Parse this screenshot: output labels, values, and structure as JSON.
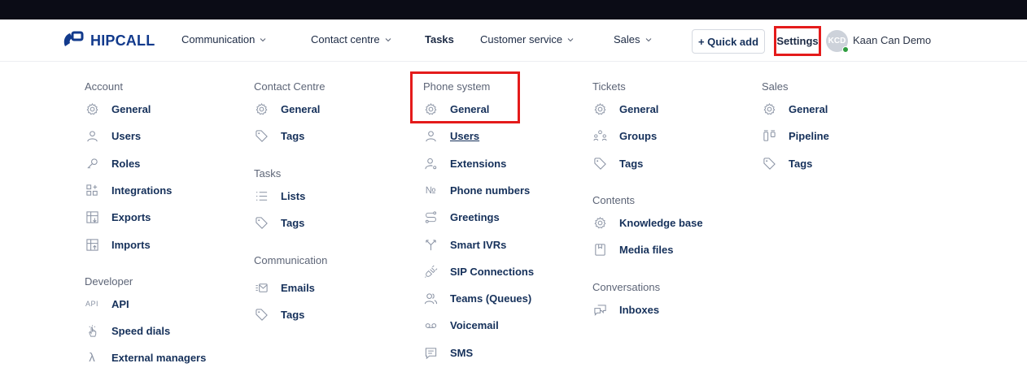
{
  "nav": {
    "brand": "HIPCALL",
    "items": [
      {
        "label": "Communication"
      },
      {
        "label": "Contact centre"
      },
      {
        "label": "Tasks"
      },
      {
        "label": "Customer service"
      },
      {
        "label": "Sales"
      }
    ],
    "quick_add": "+ Quick add",
    "settings": "Settings",
    "avatar_initials": "KCD",
    "user_name": "Kaan Can Demo"
  },
  "columns": {
    "account": {
      "title": "Account",
      "items": [
        {
          "label": "General",
          "icon": "gear-icon"
        },
        {
          "label": "Users",
          "icon": "user-icon"
        },
        {
          "label": "Roles",
          "icon": "key-icon"
        },
        {
          "label": "Integrations",
          "icon": "integrations-icon"
        },
        {
          "label": "Exports",
          "icon": "export-icon"
        },
        {
          "label": "Imports",
          "icon": "import-icon"
        }
      ]
    },
    "developer": {
      "title": "Developer",
      "items": [
        {
          "label": "API",
          "icon": "api-icon",
          "icon_text": "API"
        },
        {
          "label": "Speed dials",
          "icon": "hand-icon"
        },
        {
          "label": "External managers",
          "icon": "lambda-icon",
          "icon_text": "λ"
        }
      ]
    },
    "contact_centre": {
      "title": "Contact Centre",
      "items": [
        {
          "label": "General",
          "icon": "gear-icon"
        },
        {
          "label": "Tags",
          "icon": "tag-icon"
        }
      ]
    },
    "tasks": {
      "title": "Tasks",
      "items": [
        {
          "label": "Lists",
          "icon": "list-icon"
        },
        {
          "label": "Tags",
          "icon": "tag-icon"
        }
      ]
    },
    "communication": {
      "title": "Communication",
      "items": [
        {
          "label": "Emails",
          "icon": "email-icon"
        },
        {
          "label": "Tags",
          "icon": "tag-icon"
        }
      ]
    },
    "phone_system": {
      "title": "Phone system",
      "items": [
        {
          "label": "General",
          "icon": "gear-icon"
        },
        {
          "label": "Users",
          "icon": "user-icon"
        },
        {
          "label": "Extensions",
          "icon": "user-settings-icon"
        },
        {
          "label": "Phone numbers",
          "icon": "number-icon",
          "icon_text": "№"
        },
        {
          "label": "Greetings",
          "icon": "route-icon"
        },
        {
          "label": "Smart IVRs",
          "icon": "split-icon"
        },
        {
          "label": "SIP Connections",
          "icon": "plug-icon"
        },
        {
          "label": "Teams (Queues)",
          "icon": "team-icon"
        },
        {
          "label": "Voicemail",
          "icon": "voicemail-icon"
        },
        {
          "label": "SMS",
          "icon": "message-icon"
        }
      ]
    },
    "tickets": {
      "title": "Tickets",
      "items": [
        {
          "label": "General",
          "icon": "gear-icon"
        },
        {
          "label": "Groups",
          "icon": "group-icon"
        },
        {
          "label": "Tags",
          "icon": "tag-icon"
        }
      ]
    },
    "contents": {
      "title": "Contents",
      "items": [
        {
          "label": "Knowledge base",
          "icon": "gear-icon"
        },
        {
          "label": "Media files",
          "icon": "file-icon"
        }
      ]
    },
    "conversations": {
      "title": "Conversations",
      "items": [
        {
          "label": "Inboxes",
          "icon": "chat-icon"
        }
      ]
    },
    "sales": {
      "title": "Sales",
      "items": [
        {
          "label": "General",
          "icon": "gear-icon"
        },
        {
          "label": "Pipeline",
          "icon": "pipeline-icon"
        },
        {
          "label": "Tags",
          "icon": "tag-icon"
        }
      ]
    }
  },
  "colors": {
    "accent_red": "#e41b1b",
    "brand_blue": "#123a8c",
    "text_dark": "#15305a",
    "top_strip": "#0b0c16",
    "online_green": "#2f9d3e"
  }
}
